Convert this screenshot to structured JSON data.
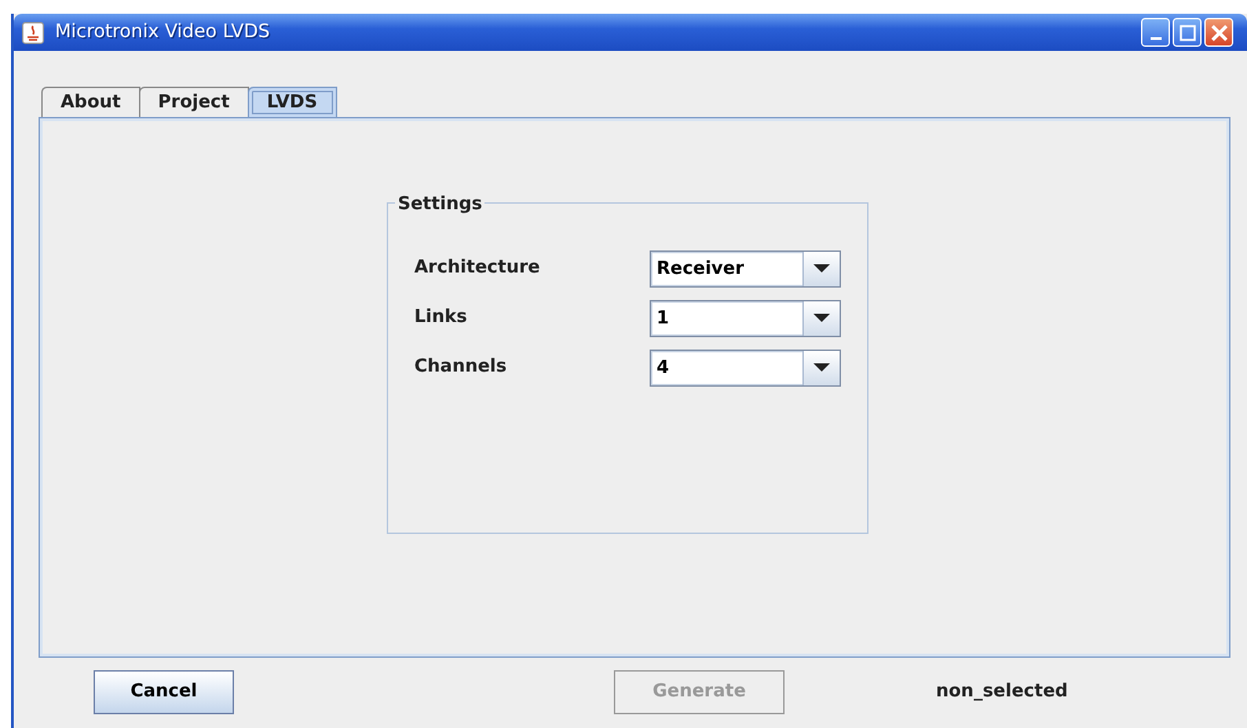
{
  "window": {
    "title": "Microtronix Video LVDS"
  },
  "tabs": [
    {
      "label": "About",
      "selected": false
    },
    {
      "label": "Project",
      "selected": false
    },
    {
      "label": "LVDS",
      "selected": true
    }
  ],
  "settings": {
    "title": "Settings",
    "fields": [
      {
        "label": "Architecture",
        "value": "Receiver"
      },
      {
        "label": "Links",
        "value": "1"
      },
      {
        "label": "Channels",
        "value": "4"
      }
    ]
  },
  "buttons": [
    {
      "label": "Cancel",
      "disabled": false
    },
    {
      "label": "Generate",
      "disabled": true
    }
  ],
  "status": "non_selected"
}
